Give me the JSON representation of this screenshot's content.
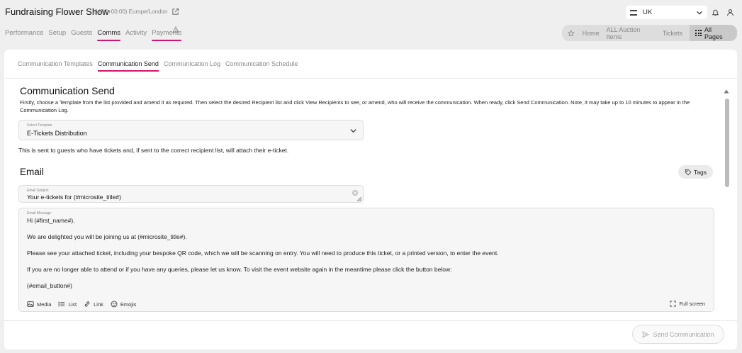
{
  "header": {
    "title": "Fundraising Flower Show",
    "timezone": "(UTC+00:00) Europe/London",
    "nav": [
      "Performance",
      "Setup",
      "Guests",
      "Comms",
      "Activity",
      "Payments"
    ],
    "region": "UK",
    "quick_links": [
      "Home",
      "ALL Auction Items",
      "Tickets"
    ],
    "all_pages_label": "All Pages"
  },
  "subtabs": [
    "Communication Templates",
    "Communication Send",
    "Communication Log",
    "Communication Schedule"
  ],
  "main": {
    "title": "Communication Send",
    "description": "Firstly, choose a Template from the list provided and amend it as required. Then select the desired Recipient list and click View Recipients to see, or amend, who will receive the communication. When ready, click Send Communication. Note, it may take up to 10 minutes to appear in the Communication Log.",
    "template_label": "Select Template",
    "template_value": "E-Tickets Distribution",
    "template_hint": "This is sent to guests who have tickets and, if sent to the correct recipient list, will attach their e-ticket.",
    "email_heading": "Email",
    "tags_label": "Tags",
    "subject_label": "Email Subject",
    "subject_value": "Your e-tickets for (#microsite_title#)",
    "message_label": "Email Message",
    "message_lines": [
      "Hi (#first_name#),",
      "We are delighted you will be joining us at (#microsite_title#).",
      "Please see your attached ticket, including your bespoke QR code, which we will be scanning on entry. You will need to produce this ticket, or a printed version, to enter the event.",
      "If you are no longer able to attend or if you have any queries, please let us know. To visit the event website again in the meantime please click the button below:",
      "(#email_button#)"
    ],
    "toolbar": {
      "media": "Media",
      "list": "List",
      "link": "Link",
      "emojis": "Emojis",
      "fullscreen": "Full screen"
    },
    "send_label": "Send Communication"
  },
  "colors": {
    "accent": "#d4146b",
    "background": "#efefef"
  }
}
